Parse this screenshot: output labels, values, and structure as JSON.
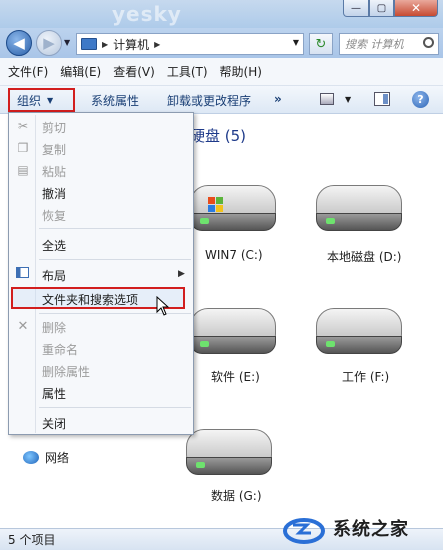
{
  "window": {
    "watermark_top": "yesky",
    "minimize_glyph": "—",
    "maximize_glyph": "▢",
    "close_glyph": "✕"
  },
  "nav": {
    "back_glyph": "◀",
    "forward_glyph": "▶",
    "breadcrumb": "计算机",
    "search_placeholder": "搜索 计算机",
    "refresh_glyph": "↻"
  },
  "menubar": {
    "items": [
      "文件(F)",
      "编辑(E)",
      "查看(V)",
      "工具(T)",
      "帮助(H)"
    ]
  },
  "toolbar": {
    "organize": "组织",
    "properties": "系统属性",
    "uninstall": "卸载或更改程序",
    "more": "»",
    "help_glyph": "?"
  },
  "content": {
    "group_header": "硬盘 (5)",
    "drives": [
      {
        "label": "WIN7 (C:)",
        "icon": "windows-drive-icon"
      },
      {
        "label": "本地磁盘 (D:)",
        "icon": "hard-drive-icon"
      },
      {
        "label": "软件 (E:)",
        "icon": "hard-drive-icon"
      },
      {
        "label": "工作 (F:)",
        "icon": "hard-drive-icon"
      },
      {
        "label": "数据 (G:)",
        "icon": "hard-drive-icon"
      }
    ],
    "network": "网络"
  },
  "organize_menu": {
    "cut": "剪切",
    "copy": "复制",
    "paste": "粘贴",
    "undo": "撤消",
    "redo": "恢复",
    "select_all": "全选",
    "layout": "布局",
    "folder_options": "文件夹和搜索选项",
    "delete": "删除",
    "rename": "重命名",
    "remove_properties": "删除属性",
    "properties": "属性",
    "close": "关闭"
  },
  "status": {
    "count": "5 个项目"
  },
  "watermark": {
    "text": "系统之家"
  },
  "colors": {
    "highlight_box": "#d21e1e",
    "toolbar_text": "#1a3f75",
    "group_header": "#1e3a8a"
  }
}
